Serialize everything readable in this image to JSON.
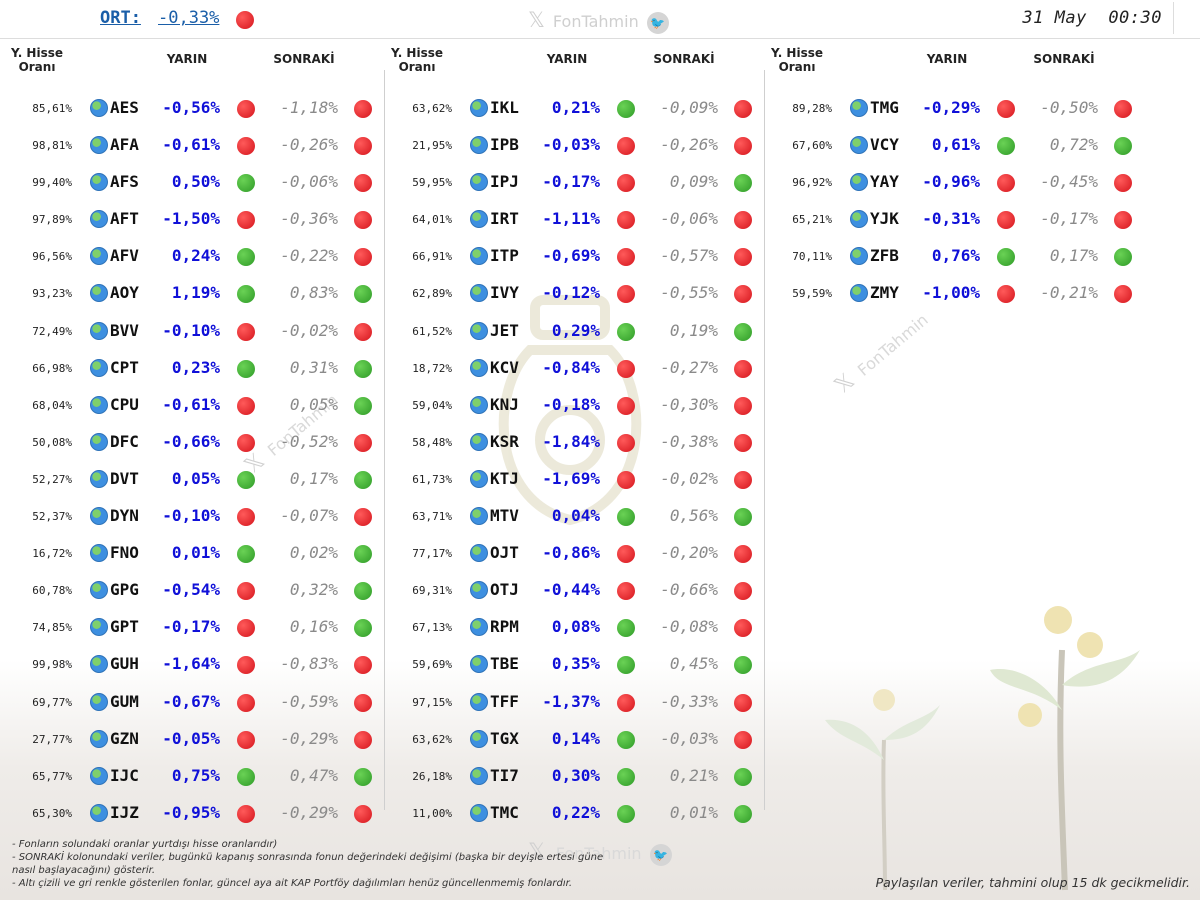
{
  "header": {
    "ort_label": "ORT:",
    "ort_value": "-0,33%",
    "ort_status": "red",
    "brand": "FonTahmin",
    "date": "31 May",
    "time": "00:30"
  },
  "columns_header": {
    "y_hisse": "Y. Hisse",
    "orani": "Oranı",
    "yarin": "YARIN",
    "sonraki": "SONRAKİ"
  },
  "columns": [
    {
      "rows": [
        {
          "pct": "85,61%",
          "code": "AES",
          "yarin": "-0,56%",
          "d1": "red",
          "sonraki": "-1,18%",
          "d2": "red"
        },
        {
          "pct": "98,81%",
          "code": "AFA",
          "yarin": "-0,61%",
          "d1": "red",
          "sonraki": "-0,26%",
          "d2": "red"
        },
        {
          "pct": "99,40%",
          "code": "AFS",
          "yarin": "0,50%",
          "d1": "green",
          "sonraki": "-0,06%",
          "d2": "red"
        },
        {
          "pct": "97,89%",
          "code": "AFT",
          "yarin": "-1,50%",
          "d1": "red",
          "sonraki": "-0,36%",
          "d2": "red"
        },
        {
          "pct": "96,56%",
          "code": "AFV",
          "yarin": "0,24%",
          "d1": "green",
          "sonraki": "-0,22%",
          "d2": "red"
        },
        {
          "pct": "93,23%",
          "code": "AOY",
          "yarin": "1,19%",
          "d1": "green",
          "sonraki": "0,83%",
          "d2": "green"
        },
        {
          "pct": "72,49%",
          "code": "BVV",
          "yarin": "-0,10%",
          "d1": "red",
          "sonraki": "-0,02%",
          "d2": "red"
        },
        {
          "pct": "66,98%",
          "code": "CPT",
          "yarin": "0,23%",
          "d1": "green",
          "sonraki": "0,31%",
          "d2": "green"
        },
        {
          "pct": "68,04%",
          "code": "CPU",
          "yarin": "-0,61%",
          "d1": "red",
          "sonraki": "0,05%",
          "d2": "green"
        },
        {
          "pct": "50,08%",
          "code": "DFC",
          "yarin": "-0,66%",
          "d1": "red",
          "sonraki": "-0,52%",
          "d2": "red"
        },
        {
          "pct": "52,27%",
          "code": "DVT",
          "yarin": "0,05%",
          "d1": "green",
          "sonraki": "0,17%",
          "d2": "green"
        },
        {
          "pct": "52,37%",
          "code": "DYN",
          "yarin": "-0,10%",
          "d1": "red",
          "sonraki": "-0,07%",
          "d2": "red"
        },
        {
          "pct": "16,72%",
          "code": "FNO",
          "yarin": "0,01%",
          "d1": "green",
          "sonraki": "0,02%",
          "d2": "green"
        },
        {
          "pct": "60,78%",
          "code": "GPG",
          "yarin": "-0,54%",
          "d1": "red",
          "sonraki": "0,32%",
          "d2": "green"
        },
        {
          "pct": "74,85%",
          "code": "GPT",
          "yarin": "-0,17%",
          "d1": "red",
          "sonraki": "0,16%",
          "d2": "green"
        },
        {
          "pct": "99,98%",
          "code": "GUH",
          "yarin": "-1,64%",
          "d1": "red",
          "sonraki": "-0,83%",
          "d2": "red"
        },
        {
          "pct": "69,77%",
          "code": "GUM",
          "yarin": "-0,67%",
          "d1": "red",
          "sonraki": "-0,59%",
          "d2": "red"
        },
        {
          "pct": "27,77%",
          "code": "GZN",
          "yarin": "-0,05%",
          "d1": "red",
          "sonraki": "-0,29%",
          "d2": "red"
        },
        {
          "pct": "65,77%",
          "code": "IJC",
          "yarin": "0,75%",
          "d1": "green",
          "sonraki": "0,47%",
          "d2": "green"
        },
        {
          "pct": "65,30%",
          "code": "IJZ",
          "yarin": "-0,95%",
          "d1": "red",
          "sonraki": "-0,29%",
          "d2": "red"
        }
      ]
    },
    {
      "rows": [
        {
          "pct": "63,62%",
          "code": "IKL",
          "yarin": "0,21%",
          "d1": "green",
          "sonraki": "-0,09%",
          "d2": "red"
        },
        {
          "pct": "21,95%",
          "code": "IPB",
          "yarin": "-0,03%",
          "d1": "red",
          "sonraki": "-0,26%",
          "d2": "red"
        },
        {
          "pct": "59,95%",
          "code": "IPJ",
          "yarin": "-0,17%",
          "d1": "red",
          "sonraki": "0,09%",
          "d2": "green"
        },
        {
          "pct": "64,01%",
          "code": "IRT",
          "yarin": "-1,11%",
          "d1": "red",
          "sonraki": "-0,06%",
          "d2": "red"
        },
        {
          "pct": "66,91%",
          "code": "ITP",
          "yarin": "-0,69%",
          "d1": "red",
          "sonraki": "-0,57%",
          "d2": "red"
        },
        {
          "pct": "62,89%",
          "code": "IVY",
          "yarin": "-0,12%",
          "d1": "red",
          "sonraki": "-0,55%",
          "d2": "red"
        },
        {
          "pct": "61,52%",
          "code": "JET",
          "yarin": "0,29%",
          "d1": "green",
          "sonraki": "0,19%",
          "d2": "green"
        },
        {
          "pct": "18,72%",
          "code": "KCV",
          "yarin": "-0,84%",
          "d1": "red",
          "sonraki": "-0,27%",
          "d2": "red"
        },
        {
          "pct": "59,04%",
          "code": "KNJ",
          "yarin": "-0,18%",
          "d1": "red",
          "sonraki": "-0,30%",
          "d2": "red"
        },
        {
          "pct": "58,48%",
          "code": "KSR",
          "yarin": "-1,84%",
          "d1": "red",
          "sonraki": "-0,38%",
          "d2": "red"
        },
        {
          "pct": "61,73%",
          "code": "KTJ",
          "yarin": "-1,69%",
          "d1": "red",
          "sonraki": "-0,02%",
          "d2": "red"
        },
        {
          "pct": "63,71%",
          "code": "MTV",
          "yarin": "0,04%",
          "d1": "green",
          "sonraki": "0,56%",
          "d2": "green"
        },
        {
          "pct": "77,17%",
          "code": "OJT",
          "yarin": "-0,86%",
          "d1": "red",
          "sonraki": "-0,20%",
          "d2": "red"
        },
        {
          "pct": "69,31%",
          "code": "OTJ",
          "yarin": "-0,44%",
          "d1": "red",
          "sonraki": "-0,66%",
          "d2": "red"
        },
        {
          "pct": "67,13%",
          "code": "RPM",
          "yarin": "0,08%",
          "d1": "green",
          "sonraki": "-0,08%",
          "d2": "red"
        },
        {
          "pct": "59,69%",
          "code": "TBE",
          "yarin": "0,35%",
          "d1": "green",
          "sonraki": "0,45%",
          "d2": "green"
        },
        {
          "pct": "97,15%",
          "code": "TFF",
          "yarin": "-1,37%",
          "d1": "red",
          "sonraki": "-0,33%",
          "d2": "red"
        },
        {
          "pct": "63,62%",
          "code": "TGX",
          "yarin": "0,14%",
          "d1": "green",
          "sonraki": "-0,03%",
          "d2": "red"
        },
        {
          "pct": "26,18%",
          "code": "TI7",
          "yarin": "0,30%",
          "d1": "green",
          "sonraki": "0,21%",
          "d2": "green"
        },
        {
          "pct": "11,00%",
          "code": "TMC",
          "yarin": "0,22%",
          "d1": "green",
          "sonraki": "0,01%",
          "d2": "green"
        }
      ]
    },
    {
      "rows": [
        {
          "pct": "89,28%",
          "code": "TMG",
          "yarin": "-0,29%",
          "d1": "red",
          "sonraki": "-0,50%",
          "d2": "red"
        },
        {
          "pct": "67,60%",
          "code": "VCY",
          "yarin": "0,61%",
          "d1": "green",
          "sonraki": "0,72%",
          "d2": "green"
        },
        {
          "pct": "96,92%",
          "code": "YAY",
          "yarin": "-0,96%",
          "d1": "red",
          "sonraki": "-0,45%",
          "d2": "red"
        },
        {
          "pct": "65,21%",
          "code": "YJK",
          "yarin": "-0,31%",
          "d1": "red",
          "sonraki": "-0,17%",
          "d2": "red"
        },
        {
          "pct": "70,11%",
          "code": "ZFB",
          "yarin": "0,76%",
          "d1": "green",
          "sonraki": "0,17%",
          "d2": "green"
        },
        {
          "pct": "59,59%",
          "code": "ZMY",
          "yarin": "-1,00%",
          "d1": "red",
          "sonraki": "-0,21%",
          "d2": "red"
        }
      ]
    }
  ],
  "footer": {
    "notes": [
      "- Fonların solundaki oranlar yurtdışı hisse oranlarıdır)",
      "- SONRAKİ kolonundaki veriler, bugünkü kapanış sonrasında fonun değerindeki değişimi (başka bir deyişle ertesi güne",
      "nasıl başlayacağını) gösterir.",
      "- Altı çizili ve gri renkle gösterilen fonlar, güncel aya ait KAP Portföy dağılımları henüz güncellenmemiş fonlardır."
    ],
    "disclaimer": "Paylaşılan veriler, tahmini olup 15 dk gecikmelidir."
  },
  "colors": {
    "red": "#d4141c",
    "green": "#2e9a27",
    "yarin_text": "#1010d8",
    "ort_link": "#1a5ea8"
  }
}
